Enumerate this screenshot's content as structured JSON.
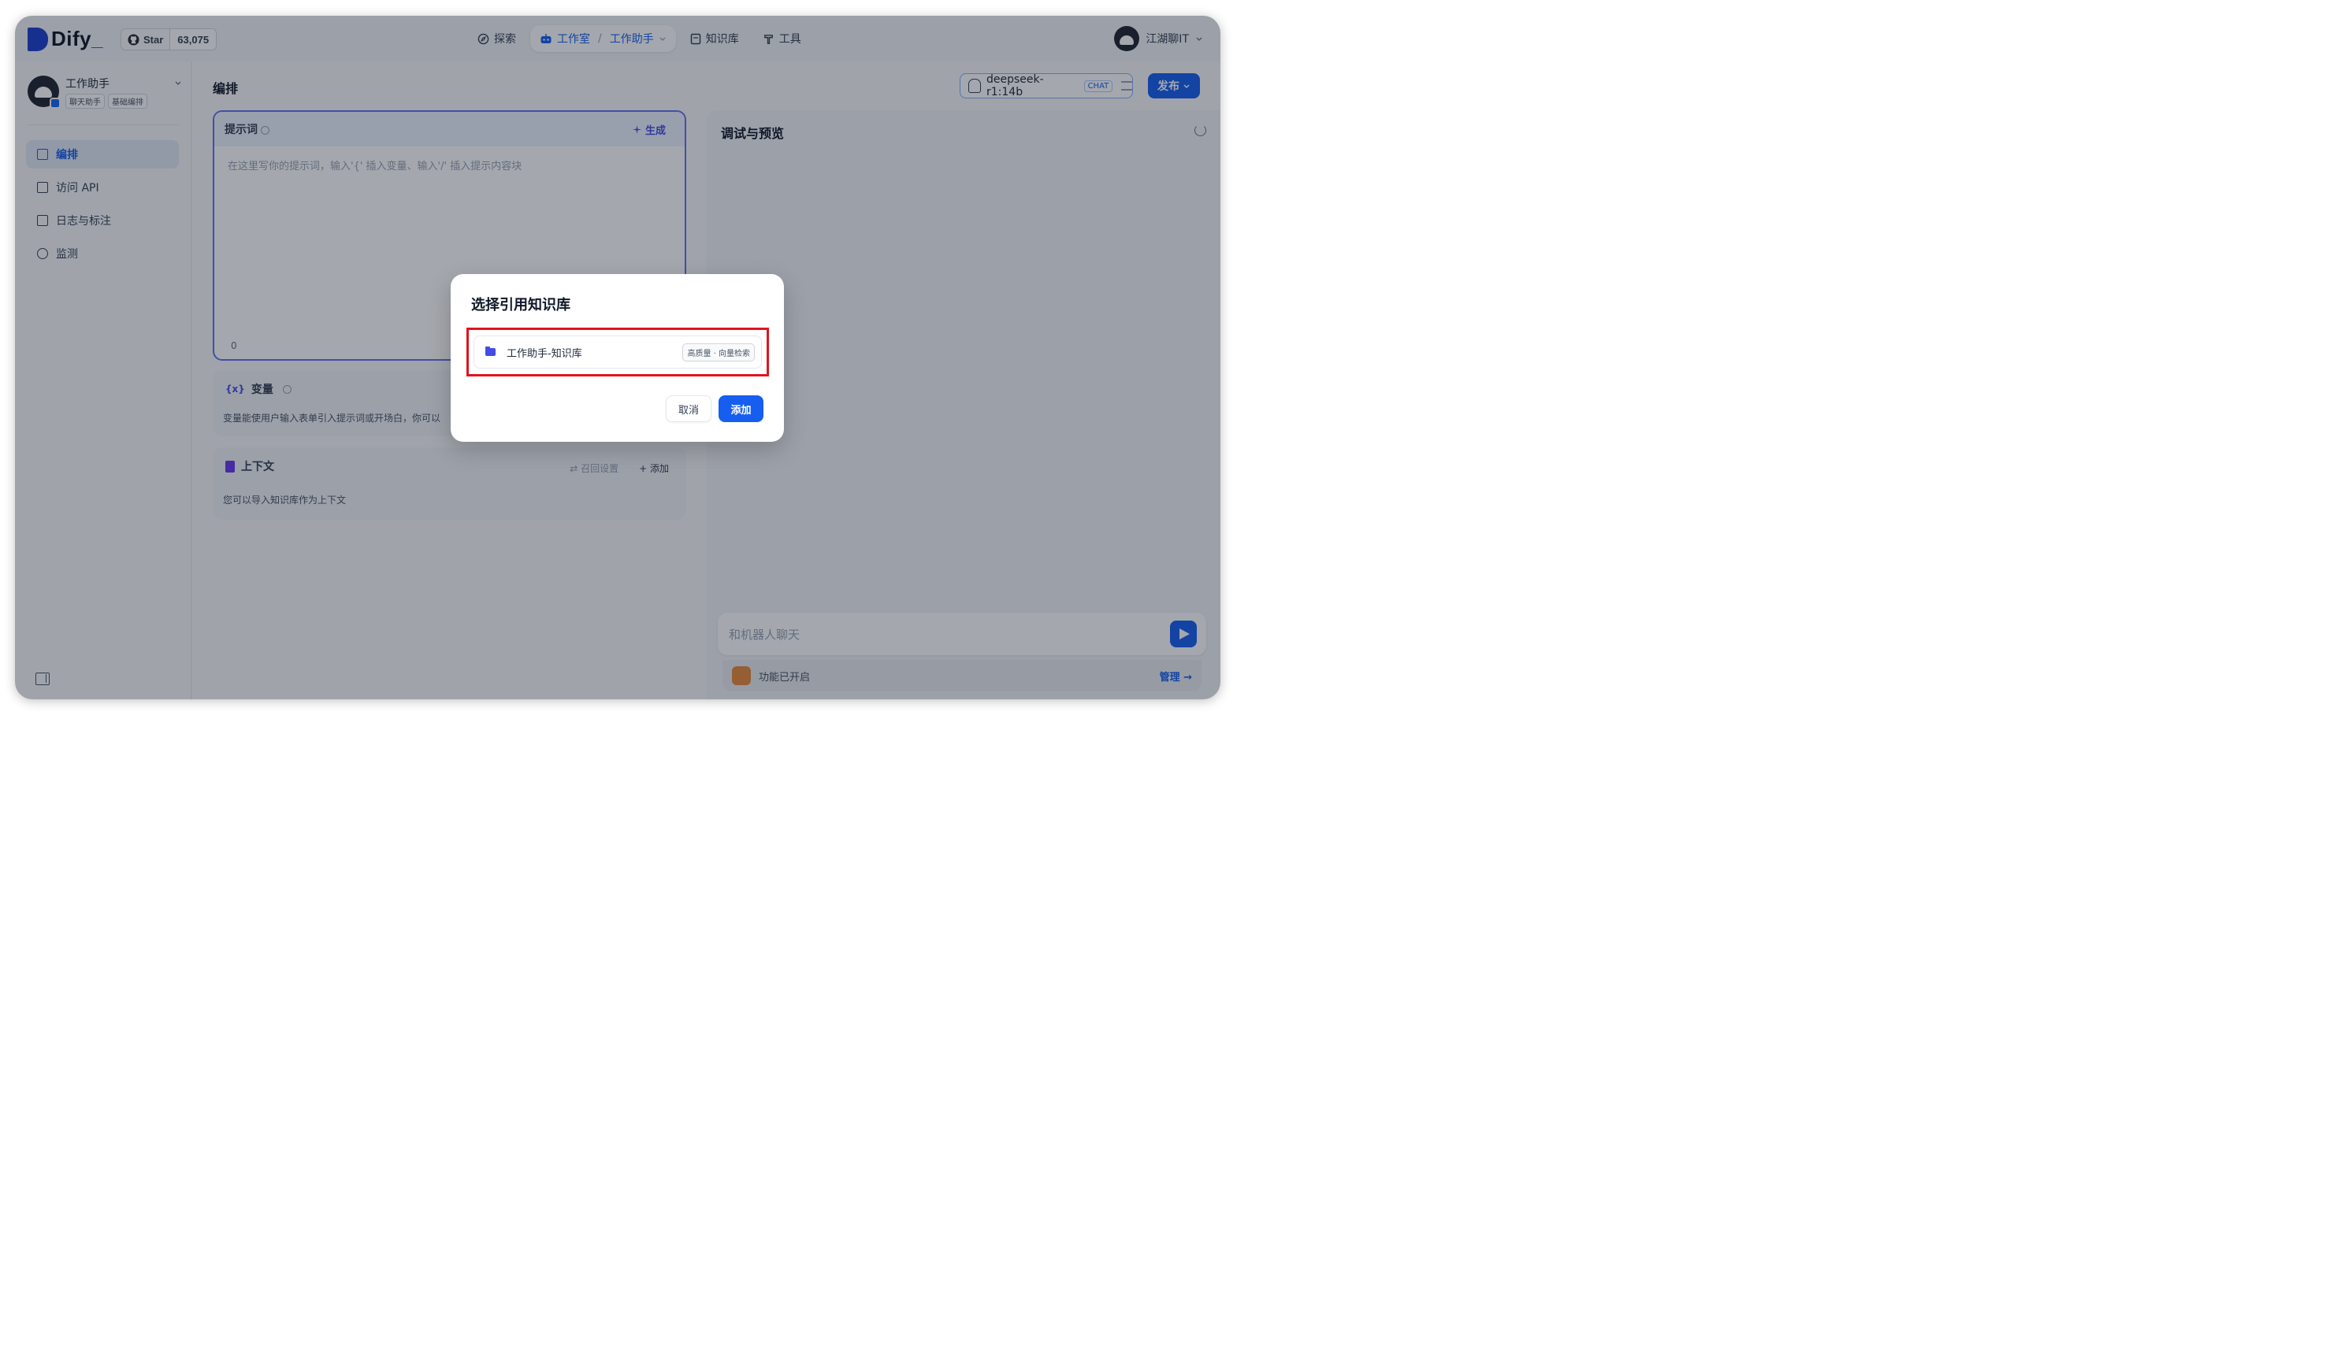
{
  "brand": {
    "name": "Dify",
    "underscore": "_"
  },
  "github": {
    "label": "Star",
    "count": "63,075"
  },
  "nav": {
    "explore": "探索",
    "studio": "工作室",
    "separator": "/",
    "current_app": "工作助手",
    "knowledge": "知识库",
    "tools": "工具"
  },
  "user": {
    "name": "江湖聊IT"
  },
  "app": {
    "name": "工作助手",
    "tags": [
      "聊天助手",
      "基础编排"
    ]
  },
  "sidebar": {
    "items": [
      {
        "label": "编排",
        "active": true
      },
      {
        "label": "访问 API",
        "active": false
      },
      {
        "label": "日志与标注",
        "active": false
      },
      {
        "label": "监测",
        "active": false
      }
    ]
  },
  "main": {
    "title": "编排",
    "model": {
      "name": "deepseek-r1:14b",
      "mode": "CHAT"
    },
    "publish_label": "发布",
    "prompt": {
      "title": "提示词",
      "generate_label": "生成",
      "placeholder": "在这里写你的提示词，输入'{' 插入变量、输入'/' 插入提示内容块",
      "char_count": "0"
    },
    "variables": {
      "title": "变量",
      "desc": "变量能使用户输入表单引入提示词或开场白，你可以"
    },
    "context": {
      "title": "上下文",
      "recall_label": "召回设置",
      "add_label": "添加",
      "desc": "您可以导入知识库作为上下文"
    }
  },
  "preview": {
    "title": "调试与预览",
    "chat_placeholder": "和机器人聊天",
    "features_label": "功能已开启",
    "manage_label": "管理"
  },
  "modal": {
    "title": "选择引用知识库",
    "item": {
      "name": "工作助手-知识库",
      "tag": "高质量 · 向量检索"
    },
    "cancel_label": "取消",
    "add_label": "添加"
  },
  "colors": {
    "accent": "#155eef",
    "highlight_border": "#e0141e"
  }
}
